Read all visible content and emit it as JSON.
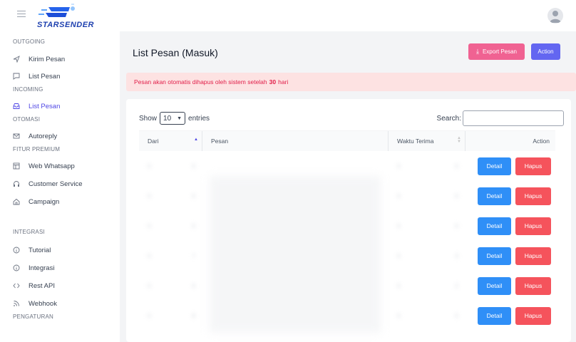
{
  "brand": {
    "name": "STARSENDER",
    "color": "#1e40af"
  },
  "sidebar": {
    "sections": [
      {
        "label": "OUTGOING"
      },
      {
        "label": "INCOMING"
      },
      {
        "label": "OTOMASI"
      },
      {
        "label": "FITUR PREMIUM"
      },
      {
        "label": "INTEGRASI"
      },
      {
        "label": "PENGATURAN"
      }
    ],
    "items": [
      {
        "label": "Kirim Pesan",
        "icon": "send-icon"
      },
      {
        "label": "List Pesan",
        "icon": "chat-icon"
      },
      {
        "label": "List Pesan",
        "icon": "inbox-icon",
        "active": true
      },
      {
        "label": "Autoreply",
        "icon": "mail-icon"
      },
      {
        "label": "Web Whatsapp",
        "icon": "browser-icon"
      },
      {
        "label": "Customer Service",
        "icon": "headset-icon"
      },
      {
        "label": "Campaign",
        "icon": "home-icon"
      },
      {
        "label": "Tutorial",
        "icon": "info-icon"
      },
      {
        "label": "Integrasi",
        "icon": "info-icon"
      },
      {
        "label": "Rest API",
        "icon": "code-icon"
      },
      {
        "label": "Webhook",
        "icon": "rss-icon"
      }
    ]
  },
  "main": {
    "title": "List Pesan (Masuk)",
    "export_label": "Export Pesan",
    "action_label": "Action",
    "alert": {
      "prefix": "Pesan akan otomatis dihapus oleh sistem setelah",
      "days": "30",
      "suffix": "hari"
    },
    "show_label": "Show",
    "entries_value": "10",
    "entries_label": "entries",
    "search_label": "Search:",
    "search_value": "",
    "columns": [
      "Dari",
      "Pesan",
      "Waktu Terima",
      "Action"
    ],
    "rows": [
      {
        "dari": "0",
        "end": "0",
        "waktu": "0",
        "wend": "0"
      },
      {
        "dari": "0",
        "end": "0",
        "waktu": "0",
        "wend": "0"
      },
      {
        "dari": "0",
        "end": "0",
        "waktu": "0",
        "wend": "0"
      },
      {
        "dari": "0",
        "end": "7",
        "waktu": "0",
        "wend": "3"
      },
      {
        "dari": "0",
        "end": "6",
        "waktu": "0",
        "wend": "2"
      },
      {
        "dari": "0",
        "end": "8",
        "waktu": "0",
        "wend": "5"
      }
    ],
    "detail_label": "Detail",
    "hapus_label": "Hapus"
  },
  "colors": {
    "accent": "#6366f1",
    "export": "#f06292",
    "detail": "#2f8ff7",
    "hapus": "#f5535c",
    "alert_bg": "#fde2e2",
    "alert_text": "#e11d48"
  }
}
